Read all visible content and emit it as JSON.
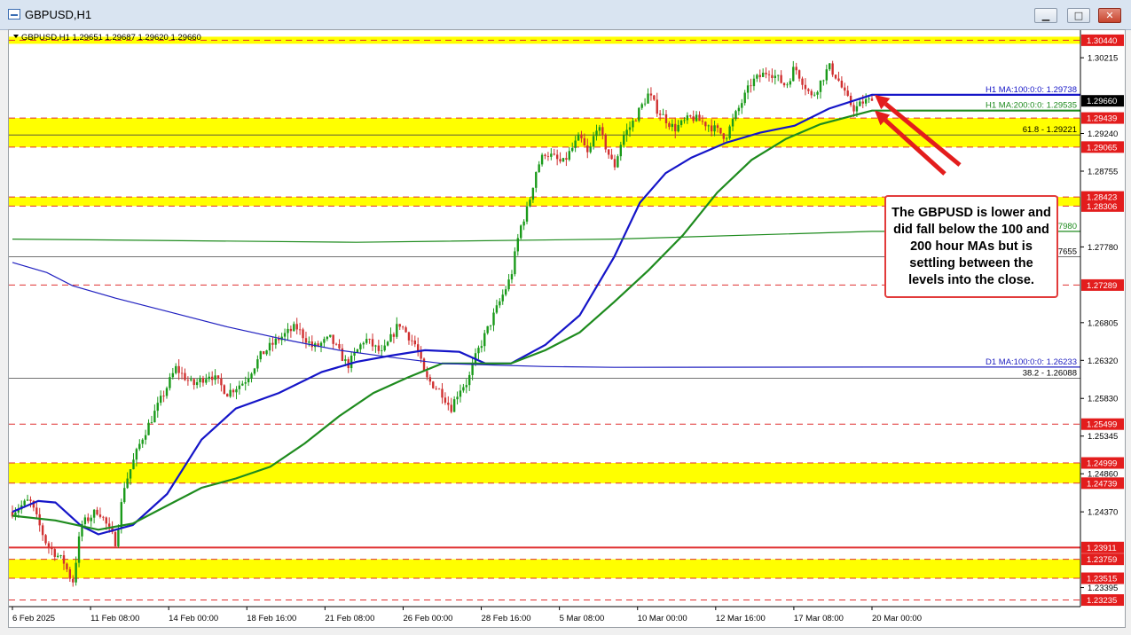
{
  "window": {
    "title": "GBPUSD,H1",
    "buttons": {
      "minimize": "▁",
      "maximize": "□",
      "close": "✕"
    }
  },
  "header_text": "GBPUSD,H1  1.29651 1.29687 1.29620 1.29660",
  "annotation": {
    "text": "The GBPUSD is lower and did fall below the 100 and 200 hour MAs but is settling between the levels into the close.",
    "color": "#e23b3b"
  },
  "colors": {
    "zone": "#ffff00",
    "ma100": "#1515c8",
    "ma200": "#1e8b1e",
    "d1_ma": "#2020c0",
    "red_level": "#e03030",
    "bull": "#1a9a1a",
    "bear": "#d03030",
    "badge": "#e31d1d"
  },
  "chart_data": {
    "type": "candlestick",
    "symbol": "GBPUSD",
    "timeframe": "H1",
    "ohlc_last": {
      "open": 1.29651,
      "high": 1.29687,
      "low": 1.2962,
      "close": 1.2966
    },
    "ylim": [
      1.2315,
      1.3057
    ],
    "x_ticks": [
      "6 Feb 2025",
      "11 Feb 08:00",
      "14 Feb 00:00",
      "18 Feb 16:00",
      "21 Feb 08:00",
      "26 Feb 00:00",
      "28 Feb 16:00",
      "5 Mar 08:00",
      "10 Mar 00:00",
      "12 Mar 16:00",
      "17 Mar 08:00",
      "20 Mar 00:00"
    ],
    "y_ticks": [
      "1.30215",
      "1.29240",
      "1.28755",
      "1.27780",
      "1.26805",
      "1.26320",
      "1.25830",
      "1.25345",
      "1.24860",
      "1.24370",
      "1.23395"
    ],
    "price_badges": [
      {
        "label": "1.30440",
        "value": 1.3044,
        "color": "red"
      },
      {
        "label": "1.29660",
        "value": 1.2966,
        "color": "black"
      },
      {
        "label": "1.29439",
        "value": 1.29439,
        "color": "red"
      },
      {
        "label": "1.29065",
        "value": 1.29065,
        "color": "red"
      },
      {
        "label": "1.28423",
        "value": 1.28423,
        "color": "red"
      },
      {
        "label": "1.28306",
        "value": 1.28306,
        "color": "red"
      },
      {
        "label": "1.27289",
        "value": 1.27289,
        "color": "red"
      },
      {
        "label": "1.25499",
        "value": 1.25499,
        "color": "red"
      },
      {
        "label": "1.24999",
        "value": 1.24999,
        "color": "red"
      },
      {
        "label": "1.24739",
        "value": 1.24739,
        "color": "red"
      },
      {
        "label": "1.23911",
        "value": 1.23911,
        "color": "red"
      },
      {
        "label": "1.23759",
        "value": 1.23759,
        "color": "red"
      },
      {
        "label": "1.23515",
        "value": 1.23515,
        "color": "red"
      },
      {
        "label": "1.23235",
        "value": 1.23235,
        "color": "red"
      }
    ],
    "yellow_zones": [
      {
        "from": 1.3044,
        "to": 1.3044
      },
      {
        "from": 1.29065,
        "to": 1.29439
      },
      {
        "from": 1.28306,
        "to": 1.28423
      },
      {
        "from": 1.24739,
        "to": 1.24999
      },
      {
        "from": 1.23515,
        "to": 1.23759
      }
    ],
    "dashed_levels": [
      1.3044,
      1.29439,
      1.29065,
      1.28423,
      1.28306,
      1.27289,
      1.25499,
      1.24999,
      1.24739,
      1.23759,
      1.23515,
      1.23235
    ],
    "solid_red_levels": [
      1.23911
    ],
    "moving_averages": [
      {
        "name": "H1 MA:100:0:0",
        "label": "H1 MA:100:0:0: 1.29738",
        "value": 1.29738,
        "color": "ma100",
        "points": [
          [
            0,
            1.2437
          ],
          [
            3,
            1.2451
          ],
          [
            5,
            1.2449
          ],
          [
            8,
            1.2419
          ],
          [
            10,
            1.2408
          ],
          [
            14,
            1.242
          ],
          [
            18,
            1.246
          ],
          [
            22,
            1.253
          ],
          [
            26,
            1.257
          ],
          [
            31,
            1.259
          ],
          [
            36,
            1.2617
          ],
          [
            40,
            1.263
          ],
          [
            44,
            1.2638
          ],
          [
            48,
            1.2645
          ],
          [
            52,
            1.2643
          ],
          [
            55,
            1.2628
          ],
          [
            58,
            1.2628
          ],
          [
            62,
            1.2652
          ],
          [
            66,
            1.269
          ],
          [
            70,
            1.2765
          ],
          [
            73,
            1.2835
          ],
          [
            76,
            1.2873
          ],
          [
            79,
            1.2893
          ],
          [
            83,
            1.2912
          ],
          [
            87,
            1.2925
          ],
          [
            91,
            1.2934
          ],
          [
            95,
            1.2956
          ],
          [
            100,
            1.29738
          ]
        ]
      },
      {
        "name": "H1 MA:200:0:0",
        "label": "H1 MA:200:0:0: 1.29535",
        "value": 1.29535,
        "color": "ma200",
        "points": [
          [
            0,
            1.2432
          ],
          [
            5,
            1.2426
          ],
          [
            10,
            1.2414
          ],
          [
            14,
            1.2422
          ],
          [
            18,
            1.2445
          ],
          [
            22,
            1.2468
          ],
          [
            26,
            1.248
          ],
          [
            30,
            1.2495
          ],
          [
            34,
            1.2525
          ],
          [
            38,
            1.256
          ],
          [
            42,
            1.259
          ],
          [
            46,
            1.261
          ],
          [
            50,
            1.2628
          ],
          [
            54,
            1.2628
          ],
          [
            58,
            1.2628
          ],
          [
            62,
            1.2645
          ],
          [
            66,
            1.2668
          ],
          [
            70,
            1.2707
          ],
          [
            74,
            1.2748
          ],
          [
            78,
            1.2793
          ],
          [
            82,
            1.2848
          ],
          [
            86,
            1.289
          ],
          [
            90,
            1.2917
          ],
          [
            94,
            1.2936
          ],
          [
            100,
            1.29535
          ]
        ]
      },
      {
        "name": "D1 MA:100:0:0",
        "label": "D1 MA:100:0:0: 1.26233",
        "value": 1.26233,
        "color": "d1_ma",
        "points": [
          [
            0,
            1.2758
          ],
          [
            4,
            1.2745
          ],
          [
            7,
            1.2728
          ],
          [
            12,
            1.2712
          ],
          [
            18,
            1.2695
          ],
          [
            25,
            1.2675
          ],
          [
            32,
            1.2658
          ],
          [
            38,
            1.2645
          ],
          [
            44,
            1.2636
          ],
          [
            50,
            1.2628
          ],
          [
            56,
            1.2626
          ],
          [
            62,
            1.2624
          ],
          [
            70,
            1.2623
          ],
          [
            100,
            1.26233
          ]
        ]
      },
      {
        "name": "D1 MA 200",
        "label": "1.27980",
        "value": 1.2798,
        "color": "ma200",
        "points": [
          [
            0,
            1.2788
          ],
          [
            40,
            1.2784
          ],
          [
            70,
            1.2788
          ],
          [
            100,
            1.2798
          ]
        ]
      }
    ],
    "fib_levels": [
      {
        "label": "61.8 - 1.29221",
        "value": 1.29221
      },
      {
        "label": "38.2 - 1.26088",
        "value": 1.26088
      },
      {
        "label": "1.27655",
        "value": 1.27655
      }
    ],
    "price_path": [
      [
        0,
        1.2437
      ],
      [
        2,
        1.2452
      ],
      [
        4,
        1.2395
      ],
      [
        6,
        1.2372
      ],
      [
        7,
        1.2345
      ],
      [
        8,
        1.242
      ],
      [
        10,
        1.244
      ],
      [
        12,
        1.2398
      ],
      [
        13,
        1.247
      ],
      [
        15,
        1.253
      ],
      [
        17,
        1.2575
      ],
      [
        19,
        1.2622
      ],
      [
        21,
        1.26
      ],
      [
        23,
        1.2615
      ],
      [
        25,
        1.259
      ],
      [
        27,
        1.2605
      ],
      [
        29,
        1.264
      ],
      [
        31,
        1.266
      ],
      [
        33,
        1.2675
      ],
      [
        35,
        1.2648
      ],
      [
        37,
        1.266
      ],
      [
        39,
        1.2625
      ],
      [
        41,
        1.266
      ],
      [
        43,
        1.264
      ],
      [
        45,
        1.268
      ],
      [
        47,
        1.265
      ],
      [
        48,
        1.261
      ],
      [
        50,
        1.259
      ],
      [
        51,
        1.257
      ],
      [
        52,
        1.2595
      ],
      [
        53,
        1.2605
      ],
      [
        54,
        1.264
      ],
      [
        56,
        1.269
      ],
      [
        58,
        1.274
      ],
      [
        59,
        1.28
      ],
      [
        60,
        1.283
      ],
      [
        61,
        1.288
      ],
      [
        62,
        1.29
      ],
      [
        64,
        1.2885
      ],
      [
        66,
        1.292
      ],
      [
        67,
        1.2895
      ],
      [
        68,
        1.2935
      ],
      [
        70,
        1.288
      ],
      [
        71,
        1.292
      ],
      [
        72,
        1.2935
      ],
      [
        74,
        1.2975
      ],
      [
        75,
        1.2955
      ],
      [
        77,
        1.293
      ],
      [
        79,
        1.2945
      ],
      [
        81,
        1.2935
      ],
      [
        83,
        1.292
      ],
      [
        84,
        1.2945
      ],
      [
        86,
        1.299
      ],
      [
        88,
        1.3005
      ],
      [
        90,
        1.2985
      ],
      [
        91,
        1.301
      ],
      [
        92,
        1.299
      ],
      [
        93,
        1.297
      ],
      [
        95,
        1.301
      ],
      [
        96,
        1.2995
      ],
      [
        97,
        1.297
      ],
      [
        98,
        1.2955
      ],
      [
        99,
        1.2965
      ],
      [
        100,
        1.2966
      ]
    ]
  }
}
